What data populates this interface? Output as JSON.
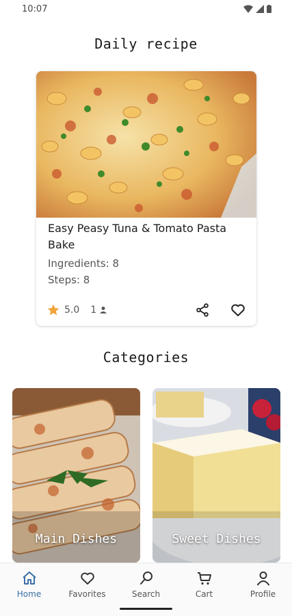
{
  "status": {
    "time": "10:07"
  },
  "daily": {
    "heading": "Daily recipe",
    "recipe": {
      "title": "Easy Peasy Tuna & Tomato Pasta Bake",
      "ingredients": "Ingredients: 8",
      "steps": "Steps: 8",
      "rating": "5.0",
      "servings": "1"
    }
  },
  "categories": {
    "heading": "Categories",
    "items": [
      {
        "label": "Main Dishes"
      },
      {
        "label": "Sweet Dishes"
      }
    ]
  },
  "nav": {
    "items": [
      {
        "label": "Home",
        "icon": "home-icon",
        "active": true
      },
      {
        "label": "Favorites",
        "icon": "heart-icon"
      },
      {
        "label": "Search",
        "icon": "search-icon"
      },
      {
        "label": "Cart",
        "icon": "cart-icon"
      },
      {
        "label": "Profile",
        "icon": "person-icon"
      }
    ]
  },
  "colors": {
    "accent": "#3a6ea5",
    "star": "#f2a33a"
  }
}
